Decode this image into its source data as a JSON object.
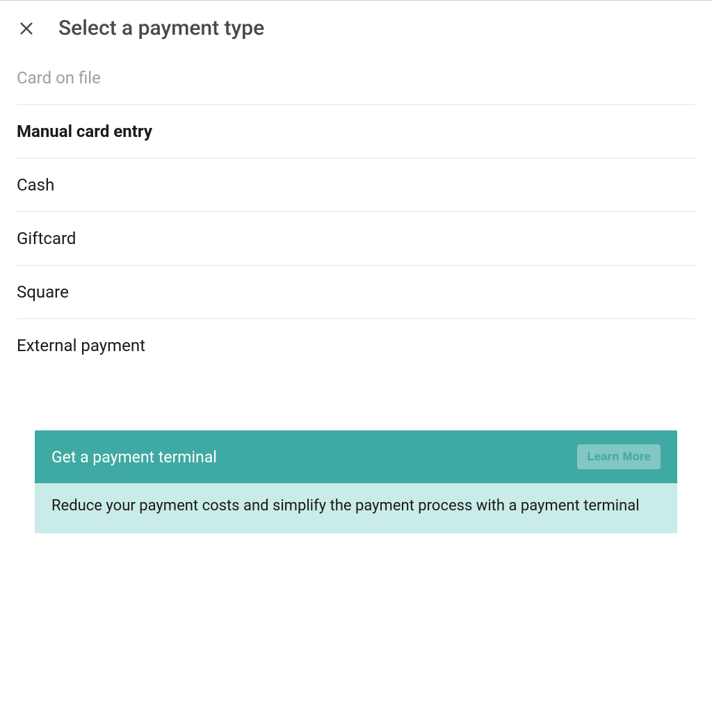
{
  "header": {
    "title": "Select a payment type"
  },
  "payment_options": [
    {
      "label": "Card on file",
      "state": "disabled"
    },
    {
      "label": "Manual card entry",
      "state": "selected"
    },
    {
      "label": "Cash",
      "state": "normal"
    },
    {
      "label": "Giftcard",
      "state": "normal"
    },
    {
      "label": "Square",
      "state": "normal"
    },
    {
      "label": "External payment",
      "state": "normal"
    }
  ],
  "promo": {
    "title": "Get a payment terminal",
    "button_label": "Learn More",
    "description": "Reduce your payment costs and simplify the payment process with a payment terminal"
  },
  "colors": {
    "teal": "#3fa9a3",
    "light_teal": "#c9ece8"
  }
}
